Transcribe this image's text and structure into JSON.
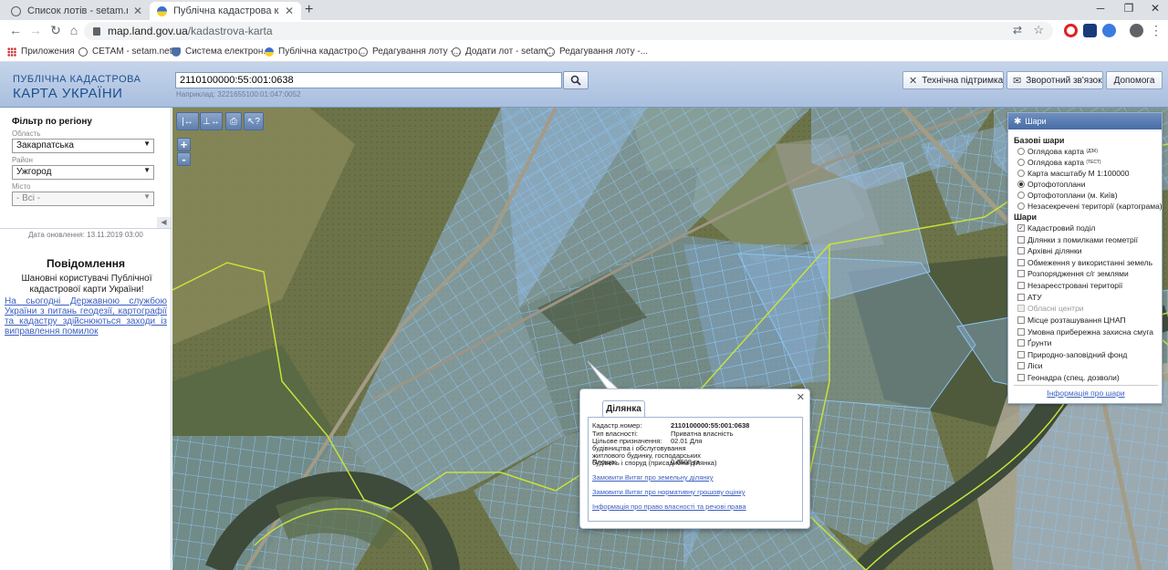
{
  "browser": {
    "tabs": [
      {
        "title": "Список лотів - setam.net.ua"
      },
      {
        "title": "Публічна кадастрова карта Укр"
      }
    ],
    "url_host": "map.land.gov.ua",
    "url_path": "/kadastrova-karta",
    "bookmarks": [
      {
        "label": "Приложения"
      },
      {
        "label": "СЕТАМ - setam.net..."
      },
      {
        "label": "Система електрон..."
      },
      {
        "label": "Публічна кадастро..."
      },
      {
        "label": "Редагування лоту -..."
      },
      {
        "label": "Додати лот - setam..."
      },
      {
        "label": "Редагування лоту -..."
      }
    ]
  },
  "header": {
    "logo_line1": "ПУБЛІЧНА КАДАСТРОВА",
    "logo_line2": "КАРТА УКРАЇНИ",
    "search_value": "2110100000:55:001:0638",
    "search_hint": "Наприклад: 3221655100:01:047:0052",
    "buttons": {
      "support": "Технічна підтримка",
      "feedback": "Зворотний зв'язок",
      "help": "Допомога"
    }
  },
  "filter": {
    "title": "Фільтр по регіону",
    "oblast_label": "Область",
    "oblast_value": "Закарпатська",
    "raion_label": "Район",
    "raion_value": "Ужгород",
    "misto_label": "Місто",
    "misto_value": "- Всі -"
  },
  "notice": {
    "updated": "Дата оновлення: 13.11.2019 03:00",
    "title": "Повідомлення",
    "greeting": "Шановні користувачі Публічної кадастрової карти України!",
    "link": "На сьогодні Державною службою України з питань геодезії, картографії та кадастру здійснюються заходи із виправлення помилок"
  },
  "map_controls": {
    "zoom_in": "+",
    "zoom_out": "-"
  },
  "layers": {
    "title": "Шари",
    "base_title": "Базові шари",
    "base": [
      {
        "label": "Оглядова карта",
        "sup": "(ДЗК)",
        "selected": false
      },
      {
        "label": "Оглядова карта",
        "sup": "(ТЕСТ)",
        "selected": false
      },
      {
        "label": "Карта масштабу М 1:100000",
        "sup": "",
        "selected": false
      },
      {
        "label": "Ортофотоплани",
        "sup": "",
        "selected": true
      },
      {
        "label": "Ортофотоплани (м. Київ)",
        "sup": "",
        "selected": false
      },
      {
        "label": "Незасекречені території (картограма)",
        "sup": "",
        "selected": false
      }
    ],
    "overlay_title": "Шари",
    "overlays": [
      {
        "label": "Кадастровий поділ",
        "checked": true,
        "disabled": false
      },
      {
        "label": "Ділянки з помилками геометрії",
        "checked": false,
        "disabled": false
      },
      {
        "label": "Архівні ділянки",
        "checked": false,
        "disabled": false
      },
      {
        "label": "Обмеження у використанні земель",
        "checked": false,
        "disabled": false
      },
      {
        "label": "Розпорядження с/г землями",
        "checked": false,
        "disabled": false
      },
      {
        "label": "Незареєстровані території",
        "checked": false,
        "disabled": false
      },
      {
        "label": "АТУ",
        "checked": false,
        "disabled": false
      },
      {
        "label": "Обласні центри",
        "checked": false,
        "disabled": true
      },
      {
        "label": "Місце розташування ЦНАП",
        "checked": false,
        "disabled": false
      },
      {
        "label": "Умовна прибережна захисна смуга",
        "checked": false,
        "disabled": false
      },
      {
        "label": "Ґрунти",
        "checked": false,
        "disabled": false
      },
      {
        "label": "Природно-заповідний фонд",
        "checked": false,
        "disabled": false
      },
      {
        "label": "Ліси",
        "checked": false,
        "disabled": false
      },
      {
        "label": "Геонадра (спец. дозволи)",
        "checked": false,
        "disabled": false
      }
    ],
    "info_link": "Інформація про шари"
  },
  "popup": {
    "tab": "Ділянка",
    "rows": [
      {
        "label": "Кадастр.номер:",
        "value": "2110100000:55:001:0638"
      },
      {
        "label": "Тип власності:",
        "value": "Приватна власність"
      },
      {
        "label": "Цільове призначення:",
        "value": "02.01 Для будівництва і обслуговування житлового будинку, господарських будівель і споруд (присадибна ділянка)"
      },
      {
        "label": "Площа:",
        "value": "0.0608 га"
      }
    ],
    "links": [
      "Замовити Витяг про земельну ділянку",
      "Замовити Витяг про нормативну грошову оцінку",
      "Інформація про право власності та речові права"
    ]
  },
  "colors": {
    "parcel_fill": "#8fb5dc",
    "parcel_stroke": "#6fa8e6",
    "admin_border": "#c6e33a",
    "river": "#3e4a3a",
    "header_bg": "#b7c9e4"
  }
}
